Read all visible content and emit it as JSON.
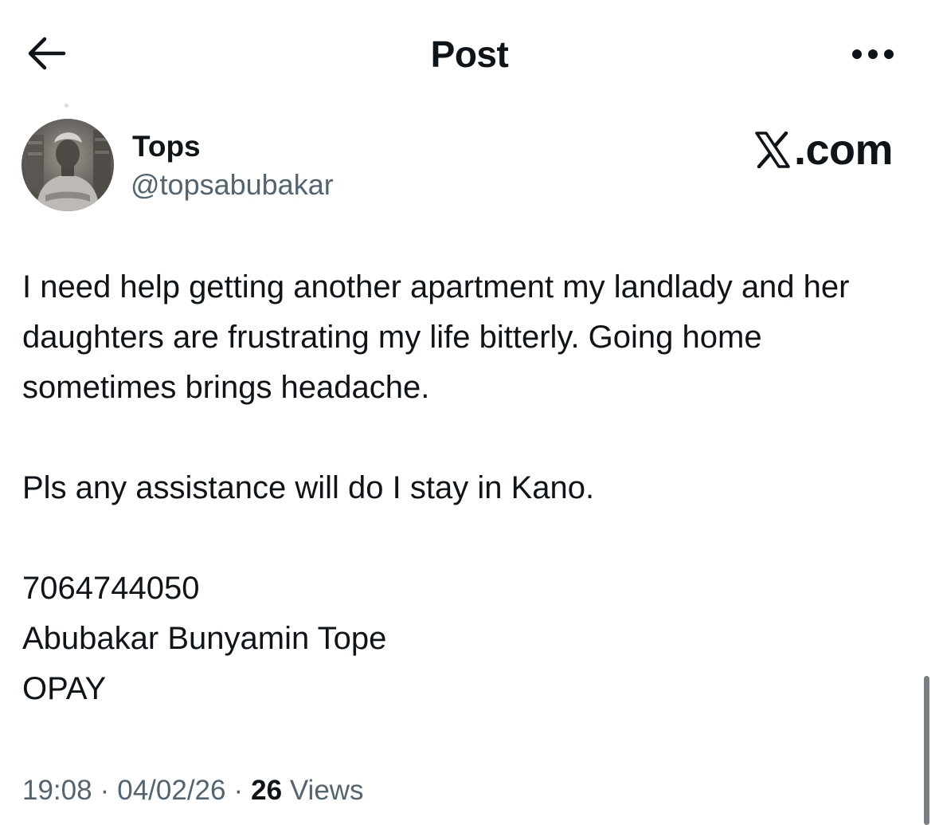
{
  "header": {
    "title": "Post",
    "back_icon": "arrow-left-icon",
    "more_icon": "more-horizontal-icon"
  },
  "author": {
    "display_name": "Tops",
    "handle": "@topsabubakar"
  },
  "watermark": {
    "text": ".com"
  },
  "post": {
    "paragraph_1": "I need help getting another apartment my landlady and her daughters are frustrating my life bitterly. Going home sometimes brings headache.",
    "paragraph_2": "Pls any assistance will do I stay in Kano.",
    "line_1": "7064744050",
    "line_2": "Abubakar Bunyamin Tope",
    "line_3": "OPAY"
  },
  "meta": {
    "time": "19:08",
    "separator": "·",
    "date": "04/02/26",
    "views_count": "26",
    "views_label": "Views"
  },
  "colors": {
    "text": "#0f1419",
    "secondary": "#536471"
  }
}
